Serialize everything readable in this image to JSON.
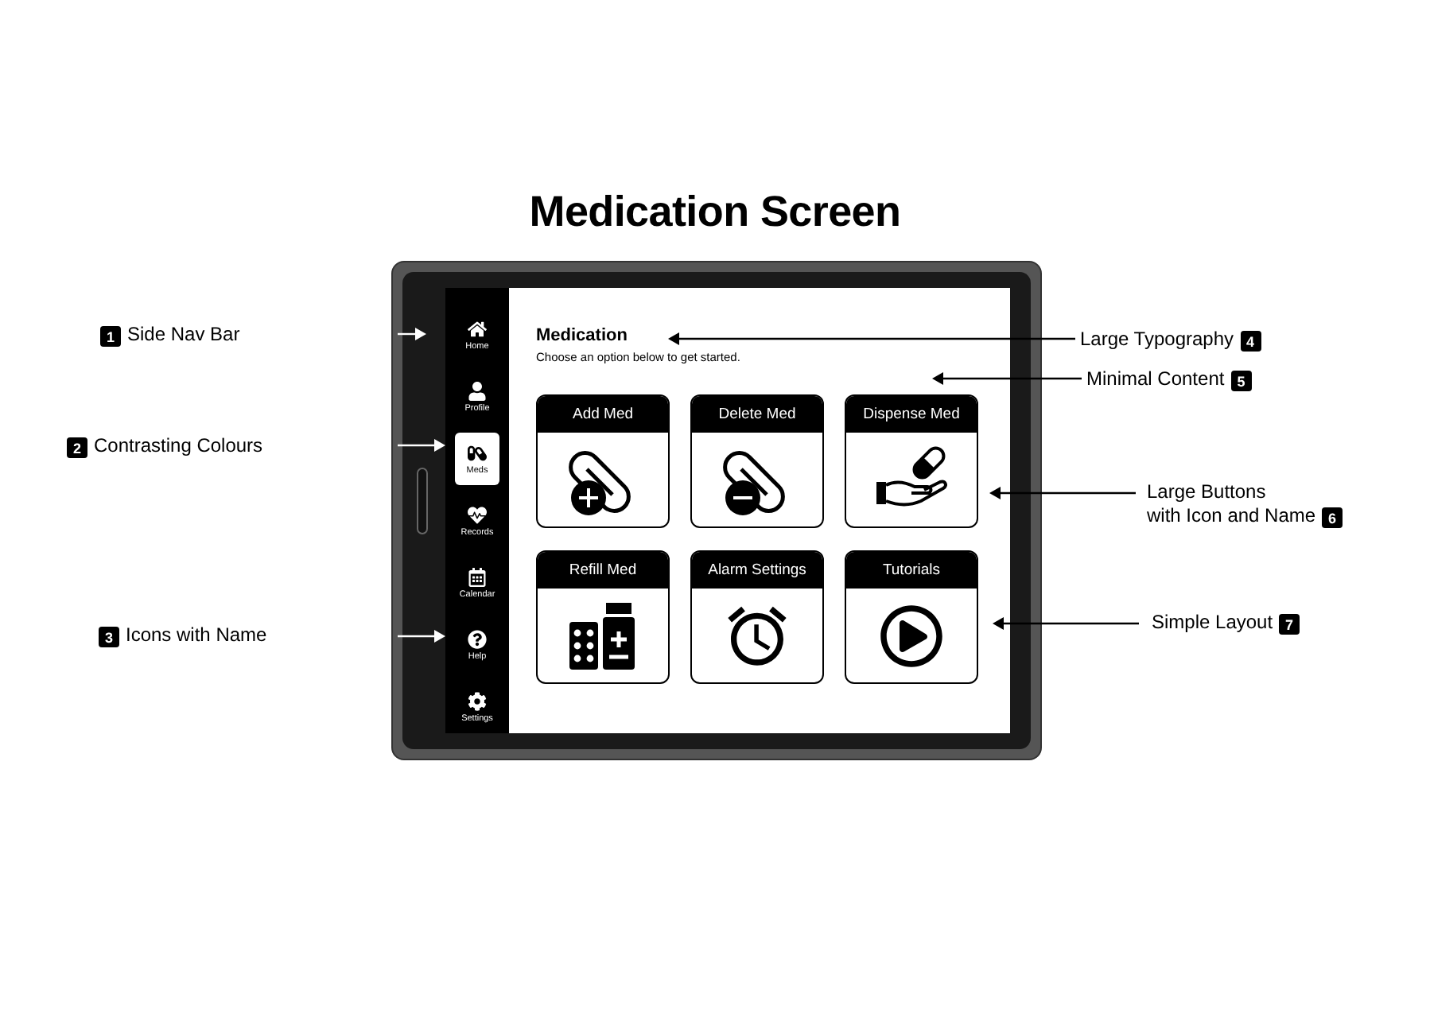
{
  "title": "Medication Screen",
  "sidebar": {
    "items": [
      {
        "label": "Home",
        "selected": false
      },
      {
        "label": "Profile",
        "selected": false
      },
      {
        "label": "Meds",
        "selected": true
      },
      {
        "label": "Records",
        "selected": false
      },
      {
        "label": "Calendar",
        "selected": false
      },
      {
        "label": "Help",
        "selected": false
      },
      {
        "label": "Settings",
        "selected": false
      }
    ]
  },
  "screen": {
    "heading": "Medication",
    "subtitle": "Choose an option below to get started.",
    "cards": [
      {
        "label": "Add Med"
      },
      {
        "label": "Delete Med"
      },
      {
        "label": "Dispense Med"
      },
      {
        "label": "Refill Med"
      },
      {
        "label": "Alarm Settings"
      },
      {
        "label": "Tutorials"
      }
    ]
  },
  "annotations": [
    {
      "number": "1",
      "lines": [
        "Side Nav Bar"
      ]
    },
    {
      "number": "2",
      "lines": [
        "Contrasting Colours"
      ]
    },
    {
      "number": "3",
      "lines": [
        "Icons with Name"
      ]
    },
    {
      "number": "4",
      "lines": [
        "Large Typography"
      ]
    },
    {
      "number": "5",
      "lines": [
        "Minimal Content"
      ]
    },
    {
      "number": "6",
      "lines": [
        "Large Buttons",
        "with Icon and Name"
      ]
    },
    {
      "number": "7",
      "lines": [
        "Simple Layout"
      ]
    }
  ]
}
